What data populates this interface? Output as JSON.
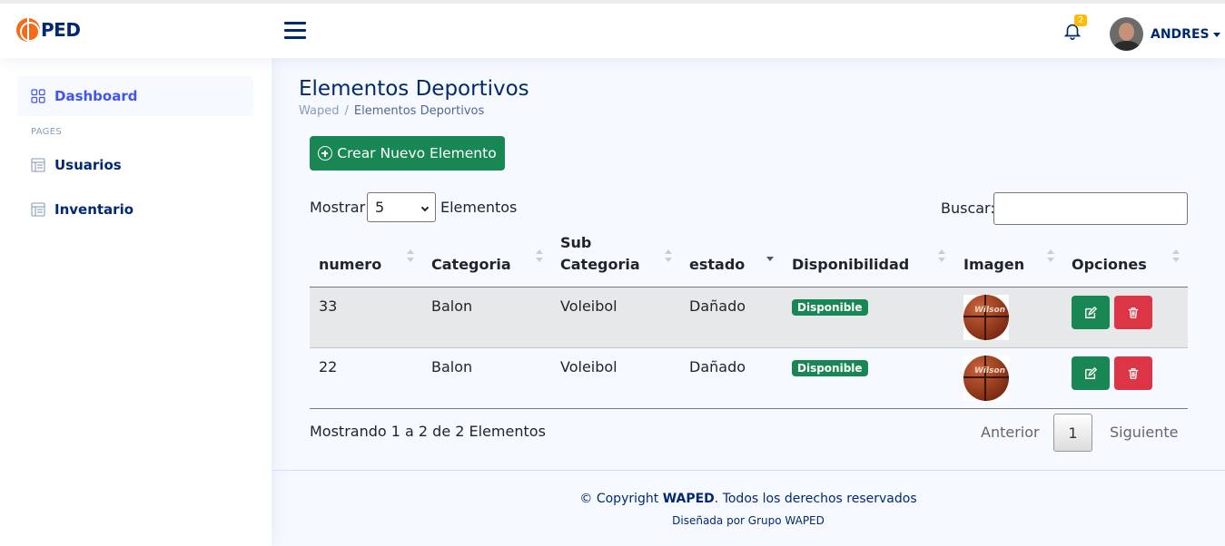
{
  "header": {
    "logo_text": "PED",
    "notification_count": "2",
    "user_name": "ANDRES"
  },
  "sidebar": {
    "dashboard_label": "Dashboard",
    "pages_heading": "PAGES",
    "items": [
      {
        "label": "Usuarios",
        "icon": "list-icon"
      },
      {
        "label": "Inventario",
        "icon": "list-icon"
      }
    ]
  },
  "main": {
    "title": "Elementos Deportivos",
    "breadcrumb": [
      "Waped",
      "Elementos Deportivos"
    ],
    "create_button": "Crear Nuevo Elemento",
    "length": {
      "label_before": "Mostrar",
      "selected": "5",
      "label_after": "Elementos"
    },
    "search_label": "Buscar:",
    "search_value": "",
    "columns": {
      "numero": "numero",
      "categoria": "Categoria",
      "sub1": "Sub",
      "sub2": "Categoria",
      "estado": "estado",
      "disponibilidad": "Disponibilidad",
      "imagen": "Imagen",
      "opciones": "Opciones"
    },
    "rows": [
      {
        "numero": "33",
        "categoria": "Balon",
        "subcategoria": "Voleibol",
        "estado": "Dañado",
        "disponibilidad": "Disponible",
        "image_text": "Wilson"
      },
      {
        "numero": "22",
        "categoria": "Balon",
        "subcategoria": "Voleibol",
        "estado": "Dañado",
        "disponibilidad": "Disponible",
        "image_text": "Wilson"
      }
    ],
    "info": "Mostrando 1 a 2 de 2 Elementos",
    "pagination": {
      "prev": "Anterior",
      "current": "1",
      "next": "Siguiente"
    }
  },
  "footer": {
    "copyright_prefix": "© Copyright ",
    "brand": "WAPED",
    "copyright_suffix": ". Todos los derechos reservados",
    "credits": "Diseñada por Grupo WAPED"
  },
  "colors": {
    "success": "#198754",
    "danger": "#dc3545",
    "primary_text": "#012970",
    "accent": "#4154f1"
  }
}
